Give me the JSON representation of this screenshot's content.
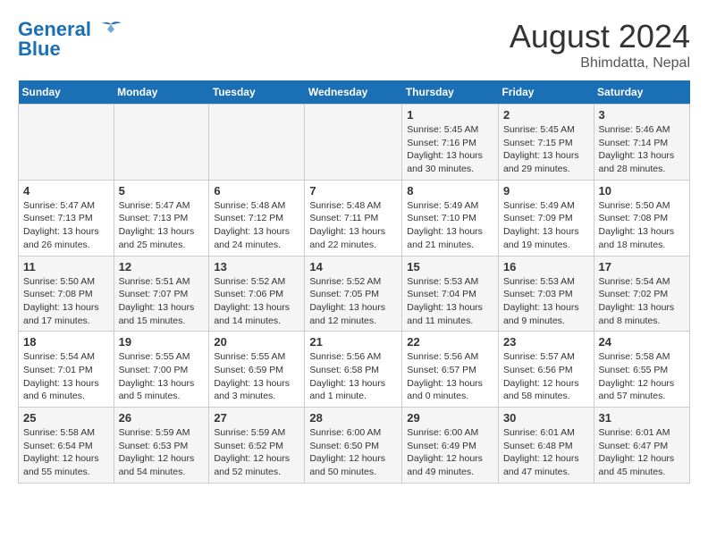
{
  "header": {
    "logo_line1": "General",
    "logo_line2": "Blue",
    "title": "August 2024",
    "subtitle": "Bhimdatta, Nepal"
  },
  "calendar": {
    "days_of_week": [
      "Sunday",
      "Monday",
      "Tuesday",
      "Wednesday",
      "Thursday",
      "Friday",
      "Saturday"
    ],
    "weeks": [
      [
        {
          "day": "",
          "info": ""
        },
        {
          "day": "",
          "info": ""
        },
        {
          "day": "",
          "info": ""
        },
        {
          "day": "",
          "info": ""
        },
        {
          "day": "1",
          "info": "Sunrise: 5:45 AM\nSunset: 7:16 PM\nDaylight: 13 hours and 30 minutes."
        },
        {
          "day": "2",
          "info": "Sunrise: 5:45 AM\nSunset: 7:15 PM\nDaylight: 13 hours and 29 minutes."
        },
        {
          "day": "3",
          "info": "Sunrise: 5:46 AM\nSunset: 7:14 PM\nDaylight: 13 hours and 28 minutes."
        }
      ],
      [
        {
          "day": "4",
          "info": "Sunrise: 5:47 AM\nSunset: 7:13 PM\nDaylight: 13 hours and 26 minutes."
        },
        {
          "day": "5",
          "info": "Sunrise: 5:47 AM\nSunset: 7:13 PM\nDaylight: 13 hours and 25 minutes."
        },
        {
          "day": "6",
          "info": "Sunrise: 5:48 AM\nSunset: 7:12 PM\nDaylight: 13 hours and 24 minutes."
        },
        {
          "day": "7",
          "info": "Sunrise: 5:48 AM\nSunset: 7:11 PM\nDaylight: 13 hours and 22 minutes."
        },
        {
          "day": "8",
          "info": "Sunrise: 5:49 AM\nSunset: 7:10 PM\nDaylight: 13 hours and 21 minutes."
        },
        {
          "day": "9",
          "info": "Sunrise: 5:49 AM\nSunset: 7:09 PM\nDaylight: 13 hours and 19 minutes."
        },
        {
          "day": "10",
          "info": "Sunrise: 5:50 AM\nSunset: 7:08 PM\nDaylight: 13 hours and 18 minutes."
        }
      ],
      [
        {
          "day": "11",
          "info": "Sunrise: 5:50 AM\nSunset: 7:08 PM\nDaylight: 13 hours and 17 minutes."
        },
        {
          "day": "12",
          "info": "Sunrise: 5:51 AM\nSunset: 7:07 PM\nDaylight: 13 hours and 15 minutes."
        },
        {
          "day": "13",
          "info": "Sunrise: 5:52 AM\nSunset: 7:06 PM\nDaylight: 13 hours and 14 minutes."
        },
        {
          "day": "14",
          "info": "Sunrise: 5:52 AM\nSunset: 7:05 PM\nDaylight: 13 hours and 12 minutes."
        },
        {
          "day": "15",
          "info": "Sunrise: 5:53 AM\nSunset: 7:04 PM\nDaylight: 13 hours and 11 minutes."
        },
        {
          "day": "16",
          "info": "Sunrise: 5:53 AM\nSunset: 7:03 PM\nDaylight: 13 hours and 9 minutes."
        },
        {
          "day": "17",
          "info": "Sunrise: 5:54 AM\nSunset: 7:02 PM\nDaylight: 13 hours and 8 minutes."
        }
      ],
      [
        {
          "day": "18",
          "info": "Sunrise: 5:54 AM\nSunset: 7:01 PM\nDaylight: 13 hours and 6 minutes."
        },
        {
          "day": "19",
          "info": "Sunrise: 5:55 AM\nSunset: 7:00 PM\nDaylight: 13 hours and 5 minutes."
        },
        {
          "day": "20",
          "info": "Sunrise: 5:55 AM\nSunset: 6:59 PM\nDaylight: 13 hours and 3 minutes."
        },
        {
          "day": "21",
          "info": "Sunrise: 5:56 AM\nSunset: 6:58 PM\nDaylight: 13 hours and 1 minute."
        },
        {
          "day": "22",
          "info": "Sunrise: 5:56 AM\nSunset: 6:57 PM\nDaylight: 13 hours and 0 minutes."
        },
        {
          "day": "23",
          "info": "Sunrise: 5:57 AM\nSunset: 6:56 PM\nDaylight: 12 hours and 58 minutes."
        },
        {
          "day": "24",
          "info": "Sunrise: 5:58 AM\nSunset: 6:55 PM\nDaylight: 12 hours and 57 minutes."
        }
      ],
      [
        {
          "day": "25",
          "info": "Sunrise: 5:58 AM\nSunset: 6:54 PM\nDaylight: 12 hours and 55 minutes."
        },
        {
          "day": "26",
          "info": "Sunrise: 5:59 AM\nSunset: 6:53 PM\nDaylight: 12 hours and 54 minutes."
        },
        {
          "day": "27",
          "info": "Sunrise: 5:59 AM\nSunset: 6:52 PM\nDaylight: 12 hours and 52 minutes."
        },
        {
          "day": "28",
          "info": "Sunrise: 6:00 AM\nSunset: 6:50 PM\nDaylight: 12 hours and 50 minutes."
        },
        {
          "day": "29",
          "info": "Sunrise: 6:00 AM\nSunset: 6:49 PM\nDaylight: 12 hours and 49 minutes."
        },
        {
          "day": "30",
          "info": "Sunrise: 6:01 AM\nSunset: 6:48 PM\nDaylight: 12 hours and 47 minutes."
        },
        {
          "day": "31",
          "info": "Sunrise: 6:01 AM\nSunset: 6:47 PM\nDaylight: 12 hours and 45 minutes."
        }
      ]
    ]
  }
}
